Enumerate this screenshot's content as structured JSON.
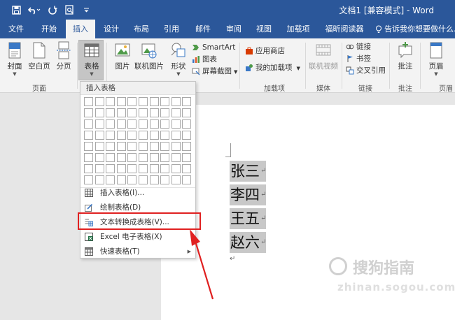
{
  "window": {
    "title": "文档1 [兼容模式] - Word"
  },
  "tabs": [
    "文件",
    "开始",
    "插入",
    "设计",
    "布局",
    "引用",
    "邮件",
    "审阅",
    "视图",
    "加载项",
    "福昕阅读器"
  ],
  "tell_me": "告诉我你想要做什么...",
  "ribbon": {
    "page_group": {
      "label": "页面",
      "cover": "封面",
      "blank": "空白页",
      "break": "分页"
    },
    "table_button": "表格",
    "illustrations": {
      "picture": "图片",
      "online_picture": "联机图片",
      "shapes": "形状",
      "smartart": "SmartArt",
      "chart": "图表",
      "screenshot": "屏幕截图"
    },
    "addins_group": {
      "label": "加载项",
      "store": "应用商店",
      "my_addins": "我的加载项"
    },
    "media_group": {
      "label": "媒体",
      "online_video": "联机视频"
    },
    "links_group": {
      "label": "链接",
      "link": "链接",
      "bookmark": "书签",
      "cross_ref": "交叉引用"
    },
    "comments_group": {
      "label": "批注",
      "comment": "批注"
    },
    "header_group": {
      "label": "页眉",
      "header": "页眉"
    }
  },
  "dropdown": {
    "header": "插入表格",
    "items": [
      "插入表格(I)...",
      "绘制表格(D)",
      "文本转换成表格(V)...",
      "Excel 电子表格(X)",
      "快速表格(T)"
    ]
  },
  "document": {
    "lines": [
      "张三",
      "李四",
      "王五",
      "赵六"
    ]
  },
  "watermark": {
    "name": "搜狗指南",
    "url": "zhinan.sogou.com"
  },
  "colors": {
    "brand": "#2b579a",
    "annotation": "#e02020",
    "highlight": "#c8c8c8"
  }
}
